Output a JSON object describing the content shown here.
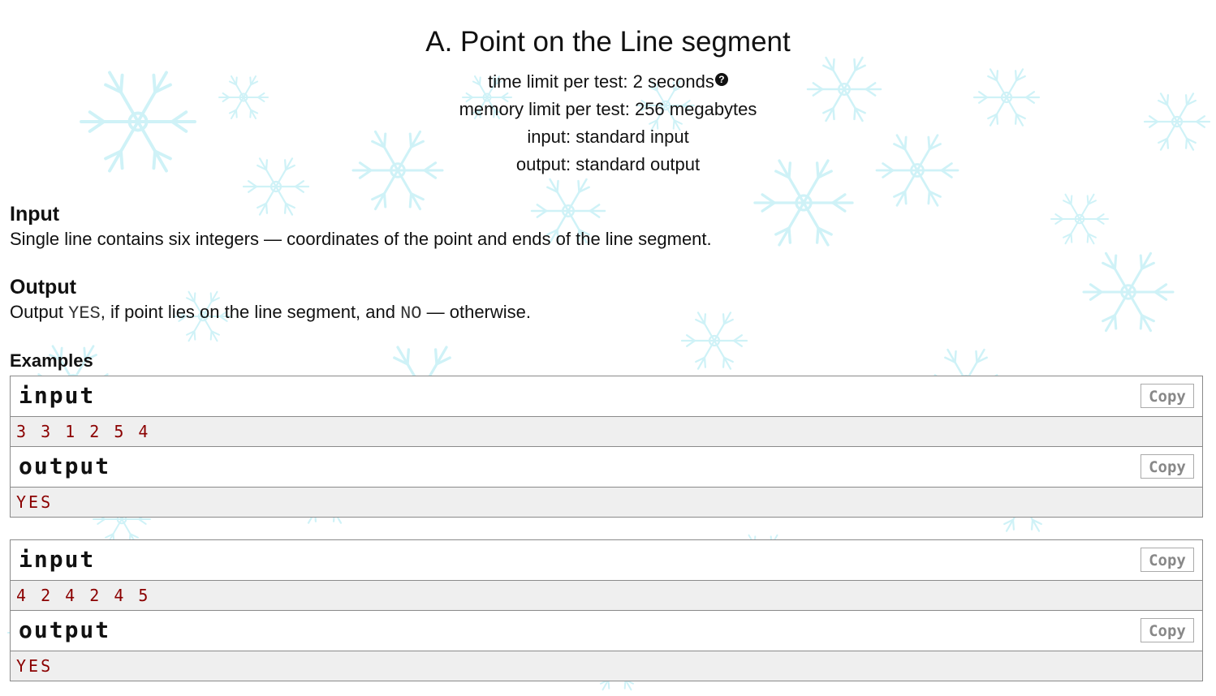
{
  "problem": {
    "title": "A. Point on the Line segment",
    "time_limit": "time limit per test: 2 seconds",
    "memory_limit": "memory limit per test: 256 megabytes",
    "input_file": "input: standard input",
    "output_file": "output: standard output",
    "help_icon_glyph": "?"
  },
  "input_section": {
    "title": "Input",
    "text": "Single line contains six integers — coordinates of the point and ends of the line segment."
  },
  "output_section": {
    "title": "Output",
    "text_before": "Output ",
    "yes_token": "YES",
    "text_middle": ", if point lies on the line segment, and ",
    "no_token": "NO",
    "text_after": " — otherwise."
  },
  "examples": {
    "title": "Examples",
    "copy_label": "Copy",
    "input_label": "input",
    "output_label": "output",
    "items": [
      {
        "input": "3 3 1 2 5 4",
        "output": "YES"
      },
      {
        "input": "4 2 4 2 4 5",
        "output": "YES"
      }
    ]
  },
  "colors": {
    "background_pattern": "#bfeef5",
    "sample_text": "#8b0000",
    "sample_bg": "#efefef",
    "border": "#8a8a8a"
  },
  "icons": {
    "help": "help-icon",
    "background": "snowflake-pattern"
  }
}
